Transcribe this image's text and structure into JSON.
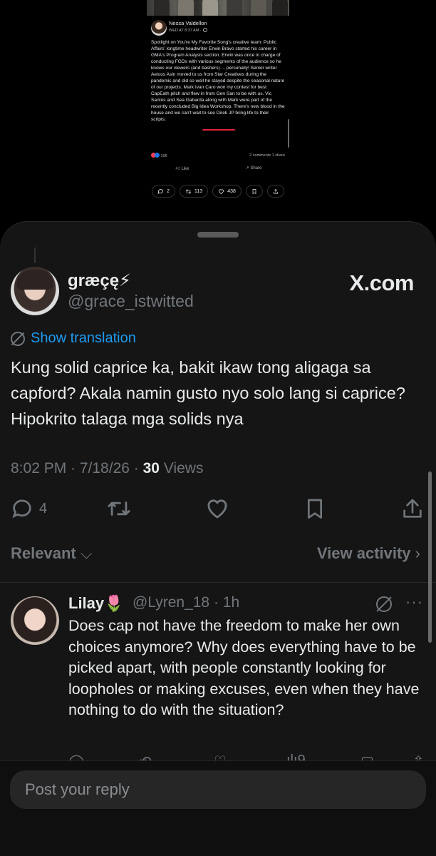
{
  "embedded_post": {
    "author": "Nessa Valdellon",
    "date": "WED AT 8:37 AM ·",
    "body": "Spotlight on You're My Favorite Song's creative team: Public Affairs' longtime headwriter Erwin Bravo started his career in GMA's Program Analysis section. Erwin was once in charge of conducting FGDs with various segments of the audience so he knows our viewers (and bashers) ... personally! Senior writer Aeious Asin moved to us from Star Creatives during the pandemic and did so well he stayed despite the seasonal nature of our projects. Mark Ivan Caro won my contest for best CapEath pitch and flew in from Gen San to be with us. Vic Santos and Sea Gabarda along with Mark were part of the recently concluded Big Idea Workshop. There's new blood in the house and we can't wait to see Direk JP bring life to their scripts.",
    "reactions": "106",
    "comments_shares": "2 comments 1 share",
    "like_label": "Like",
    "share_label": "Share",
    "pills": {
      "replies": "2",
      "reposts": "113",
      "likes": "438"
    }
  },
  "post": {
    "author_name": "græçę⚡",
    "author_handle": "@grace_istwitted",
    "brand": "X.com",
    "translate_label": "Show translation",
    "text": "Kung solid caprice ka, bakit ikaw tong aligaga sa capford? Akala namin gusto nyo solo lang si caprice? Hipokrito talaga mga solids nya",
    "time": "8:02 PM · 7/18/26 · ",
    "views_count": "30",
    "views_label": " Views",
    "reply_count": "4"
  },
  "sort": {
    "label": "Relevant",
    "view_activity": "View activity"
  },
  "reply": {
    "name": "Lilay🌷",
    "handle": "@Lyren_18 · 1h",
    "text": "Does cap not have the freedom to make her own choices anymore? Why does everything have to be picked apart, with people constantly looking for loopholes or making excuses, even when they have nothing to do with the situation?",
    "views": "9"
  },
  "compose": {
    "placeholder": "Post your reply"
  },
  "colors": {
    "accent": "#1d9bf0",
    "muted": "#71767b",
    "text": "#e7e9ea",
    "sheet": "#151515",
    "underline": "#e0243a"
  }
}
